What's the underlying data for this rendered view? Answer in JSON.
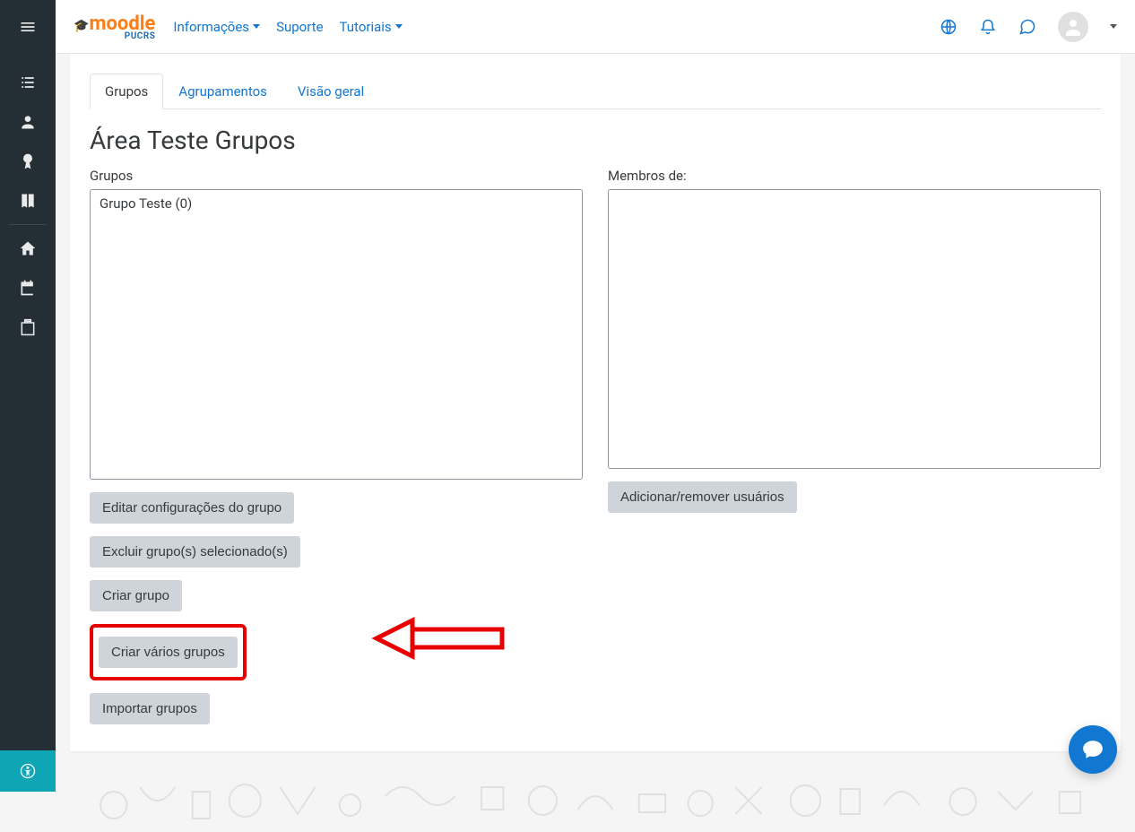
{
  "topnav": {
    "informacoes": "Informações",
    "suporte": "Suporte",
    "tutoriais": "Tutoriais"
  },
  "tabs": {
    "grupos": "Grupos",
    "agrupamentos": "Agrupamentos",
    "visao_geral": "Visão geral"
  },
  "page_title": "Área Teste Grupos",
  "left": {
    "label": "Grupos",
    "items": [
      "Grupo Teste (0)"
    ],
    "btn_editar": "Editar configurações do grupo",
    "btn_excluir": "Excluir grupo(s) selecionado(s)",
    "btn_criar": "Criar grupo",
    "btn_criar_varios": "Criar vários grupos",
    "btn_importar": "Importar grupos"
  },
  "right": {
    "label": "Membros de:",
    "btn_add": "Adicionar/remover usuários"
  }
}
